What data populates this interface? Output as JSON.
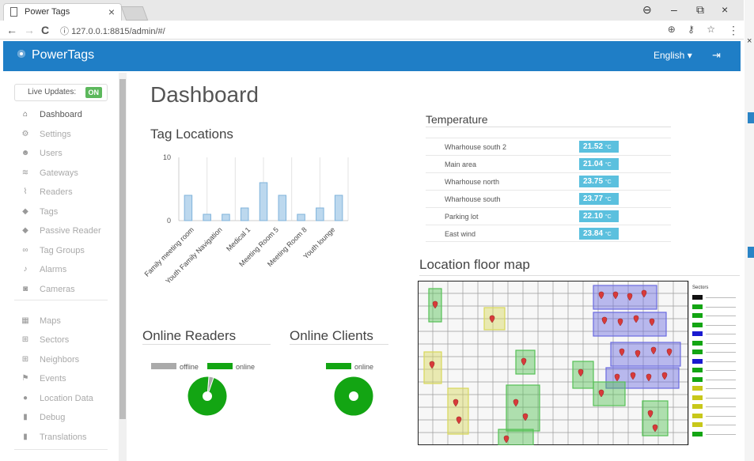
{
  "browser": {
    "tab_title": "Power Tags",
    "tab_close": "×",
    "url": "127.0.0.1:8815/admin/#/",
    "nav_back": "←",
    "nav_forward": "→",
    "nav_reload": "C",
    "url_info": "ⓘ",
    "url_actions": "⊕ ⚷ ☆",
    "menu": "⋮",
    "win_account": "⊖",
    "win_min": "–",
    "win_max": "⧉",
    "win_close": "×",
    "edge_close": "×"
  },
  "app": {
    "brand": "PowerTags",
    "language": "English ▾",
    "logout_icon": "⇥"
  },
  "sidebar": {
    "live_updates_label": "Live Updates:",
    "live_updates_state": "ON",
    "items": [
      {
        "label": "Dashboard",
        "icon": "home-icon",
        "glyph": "⌂"
      },
      {
        "label": "Settings",
        "icon": "gear-icon",
        "glyph": "⚙"
      },
      {
        "label": "Users",
        "icon": "users-icon",
        "glyph": "☻"
      },
      {
        "label": "Gateways",
        "icon": "wifi-icon",
        "glyph": "≋"
      },
      {
        "label": "Readers",
        "icon": "rss-icon",
        "glyph": "⌇"
      },
      {
        "label": "Tags",
        "icon": "tag-icon",
        "glyph": "◆"
      },
      {
        "label": "Passive Reader",
        "icon": "tags-icon",
        "glyph": "◆"
      },
      {
        "label": "Tag Groups",
        "icon": "link-icon",
        "glyph": "∞"
      },
      {
        "label": "Alarms",
        "icon": "bell-icon",
        "glyph": "♪"
      },
      {
        "label": "Cameras",
        "icon": "camera-icon",
        "glyph": "◙"
      },
      {
        "label": "Maps",
        "icon": "map-icon",
        "glyph": "▦"
      },
      {
        "label": "Sectors",
        "icon": "sectors-icon",
        "glyph": "⊞"
      },
      {
        "label": "Neighbors",
        "icon": "neighbors-icon",
        "glyph": "⊞"
      },
      {
        "label": "Events",
        "icon": "flag-icon",
        "glyph": "⚑"
      },
      {
        "label": "Location Data",
        "icon": "map-marker-icon",
        "glyph": "●"
      },
      {
        "label": "Debug",
        "icon": "file-icon",
        "glyph": "▮"
      },
      {
        "label": "Translations",
        "icon": "file-icon",
        "glyph": "▮"
      }
    ]
  },
  "main": {
    "title": "Dashboard",
    "tag_locations_title": "Tag Locations",
    "temperature_title": "Temperature",
    "online_readers_title": "Online Readers",
    "online_clients_title": "Online Clients",
    "floor_map_title": "Location floor map"
  },
  "temperatures": [
    {
      "name": "Wharhouse south 2",
      "value": "21.52",
      "unit": "°C"
    },
    {
      "name": "Main area",
      "value": "21.04",
      "unit": "°C"
    },
    {
      "name": "Wharhouse north",
      "value": "23.75",
      "unit": "°C"
    },
    {
      "name": "Wharhouse south",
      "value": "23.77",
      "unit": "°C"
    },
    {
      "name": "Parking lot",
      "value": "22.10",
      "unit": "°C"
    },
    {
      "name": "East wind",
      "value": "23.84",
      "unit": "°C"
    }
  ],
  "chart_data": [
    {
      "type": "bar",
      "ylim": [
        0,
        10
      ],
      "yticks": [
        "0",
        "10"
      ],
      "categories": [
        "Family meeting room",
        "Youth Family Navigation",
        "Medical 1",
        "Meeting Room 5",
        "Meeting Room 8",
        "Youth lounge"
      ],
      "values": [
        4,
        1,
        1,
        2,
        6,
        4,
        1,
        2,
        4
      ],
      "color": "#bcd8ee",
      "stroke": "#7fb3db"
    },
    {
      "type": "pie",
      "legend": [
        {
          "label": "offline",
          "color": "#aaaaaa"
        },
        {
          "label": "online",
          "color": "#13a513"
        }
      ],
      "slices": [
        {
          "label": "offline",
          "value": 0.04
        },
        {
          "label": "online",
          "value": 0.96
        }
      ]
    },
    {
      "type": "pie",
      "legend": [
        {
          "label": "online",
          "color": "#13a513"
        }
      ],
      "slices": [
        {
          "label": "online",
          "value": 1.0
        }
      ]
    }
  ],
  "map_legend": {
    "title": "Sectors",
    "chip_colors": [
      "#111111",
      "#13a513",
      "#13a513",
      "#13a513",
      "#1a1ad0",
      "#13a513",
      "#13a513",
      "#1a1ad0",
      "#13a513",
      "#13a513",
      "#c8c81a",
      "#c8c81a",
      "#c8c81a",
      "#c8c81a",
      "#c8c81a",
      "#13a513"
    ]
  }
}
